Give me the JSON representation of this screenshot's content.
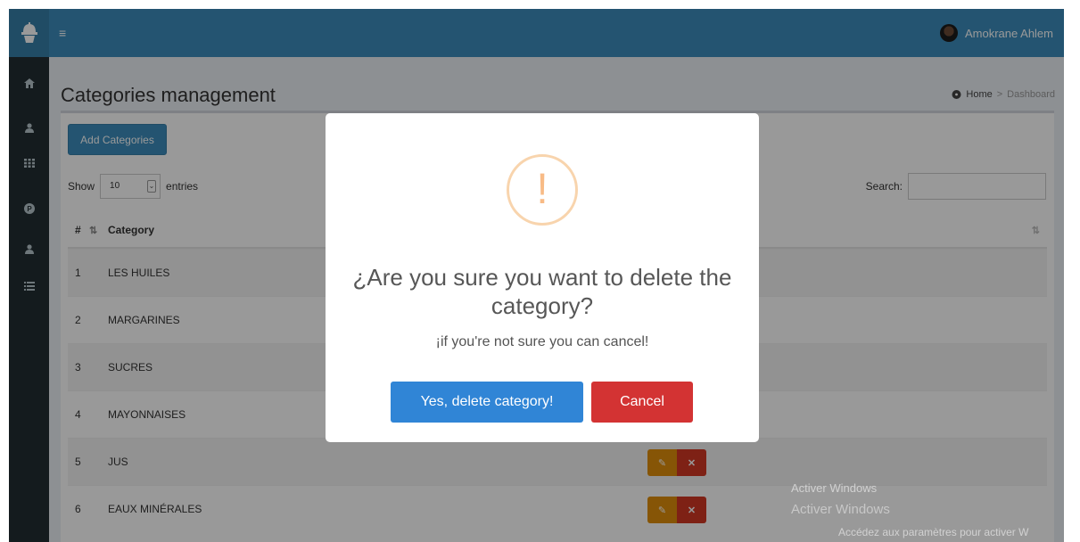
{
  "header": {
    "user_name": "Amokrane Ahlem",
    "toggle_icon": "≡"
  },
  "sidebar": {
    "icons": [
      "home-icon",
      "user-icon",
      "grid-icon",
      "p-circle-icon",
      "user-icon",
      "list-icon"
    ]
  },
  "page": {
    "title": "Categories management",
    "breadcrumb": [
      "Home",
      "Dashboard"
    ]
  },
  "toolbar": {
    "add_label": "Add Categories",
    "show_label": "Show",
    "show_value": "10",
    "entries_label": "entries",
    "search_label": "Search:"
  },
  "table": {
    "headers": [
      "#",
      "Category"
    ],
    "rows": [
      {
        "num": "1",
        "category": "LES HUILES"
      },
      {
        "num": "2",
        "category": "MARGARINES"
      },
      {
        "num": "3",
        "category": "SUCRES"
      },
      {
        "num": "4",
        "category": "MAYONNAISES"
      },
      {
        "num": "5",
        "category": "JUS"
      },
      {
        "num": "6",
        "category": "EAUX MINÉRALES"
      }
    ]
  },
  "modal": {
    "icon": "!",
    "title": "¿Are you sure you want to delete the category?",
    "text": "¡if you're not sure you can cancel!",
    "confirm_label": "Yes, delete category!",
    "cancel_label": "Cancel"
  },
  "watermark": {
    "line1": "Activer Windows",
    "line2": "Activer Windows",
    "line3": "Accédez aux paramètres pour activer W"
  },
  "colors": {
    "header": "#3c8dbc",
    "sidebar": "#222d32",
    "confirm": "#3085d6",
    "cancel": "#d33333",
    "warning": "#f8bb86"
  }
}
